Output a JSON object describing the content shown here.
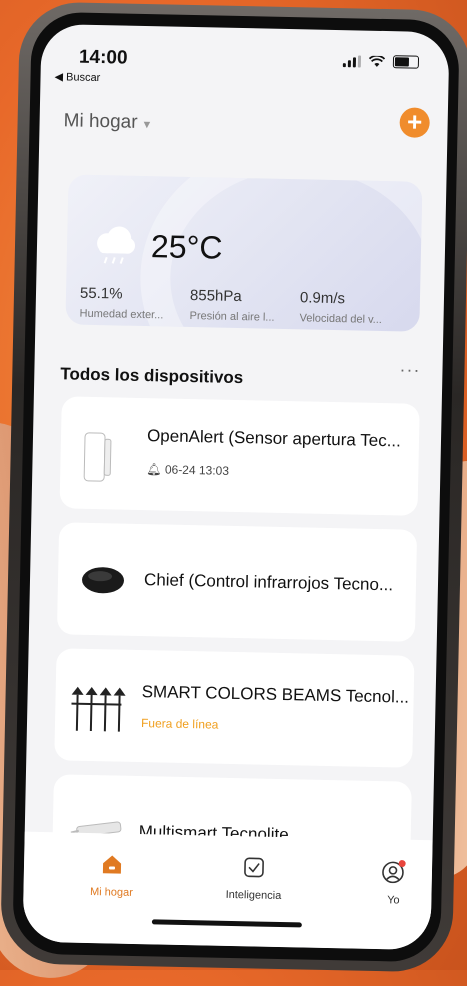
{
  "status_bar": {
    "time": "14:00",
    "back_label": "◀ Buscar"
  },
  "header": {
    "home_name": "Mi hogar",
    "add_label": "+"
  },
  "weather": {
    "temperature": "25°C",
    "stats": [
      {
        "value": "55.1%",
        "label": "Humedad exter..."
      },
      {
        "value": "855hPa",
        "label": "Presión al aire l..."
      },
      {
        "value": "0.9m/s",
        "label": "Velocidad del v..."
      }
    ]
  },
  "devices_section": {
    "title": "Todos los dispositivos",
    "more_label": "···"
  },
  "devices": [
    {
      "name": "OpenAlert (Sensor apertura Tec...",
      "sub": "06-24 13:03",
      "status": "alert"
    },
    {
      "name": "Chief (Control infrarrojos Tecno...",
      "sub": "",
      "status": "online"
    },
    {
      "name": "SMART COLORS BEAMS Tecnol...",
      "sub": "Fuera de línea",
      "status": "offline"
    },
    {
      "name": "Multismart Tecnolite",
      "sub": "",
      "status": "online"
    }
  ],
  "tabs": [
    {
      "label": "Mi hogar",
      "icon": "home-icon",
      "active": true
    },
    {
      "label": "Inteligencia",
      "icon": "checkbox-icon",
      "active": false
    },
    {
      "label": "Yo",
      "icon": "profile-icon",
      "active": false
    }
  ],
  "colors": {
    "accent": "#f08c2c",
    "offline": "#f0a020"
  }
}
